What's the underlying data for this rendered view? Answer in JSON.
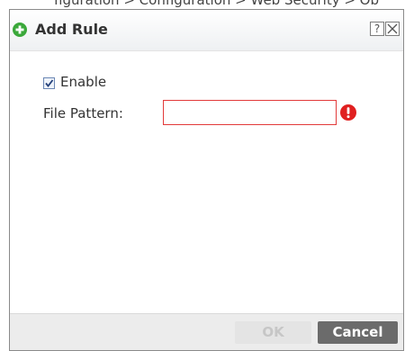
{
  "background_text": "figuration > Configuration > Web Security > Ob",
  "dialog": {
    "title": "Add Rule",
    "help_label": "?",
    "icons": {
      "title_icon": "add-circle-icon",
      "help": "question-mark-icon",
      "close": "close-icon",
      "error": "error-exclamation-icon"
    },
    "colors": {
      "title_icon": "#3aa83a",
      "error": "#e02020",
      "input_error_border": "#e23a3a",
      "cancel_bg": "#6b6b6b"
    }
  },
  "form": {
    "enable": {
      "label": "Enable",
      "checked": true
    },
    "file_pattern": {
      "label": "File Pattern:",
      "value": ""
    }
  },
  "footer": {
    "ok_label": "OK",
    "ok_disabled": true,
    "cancel_label": "Cancel"
  }
}
